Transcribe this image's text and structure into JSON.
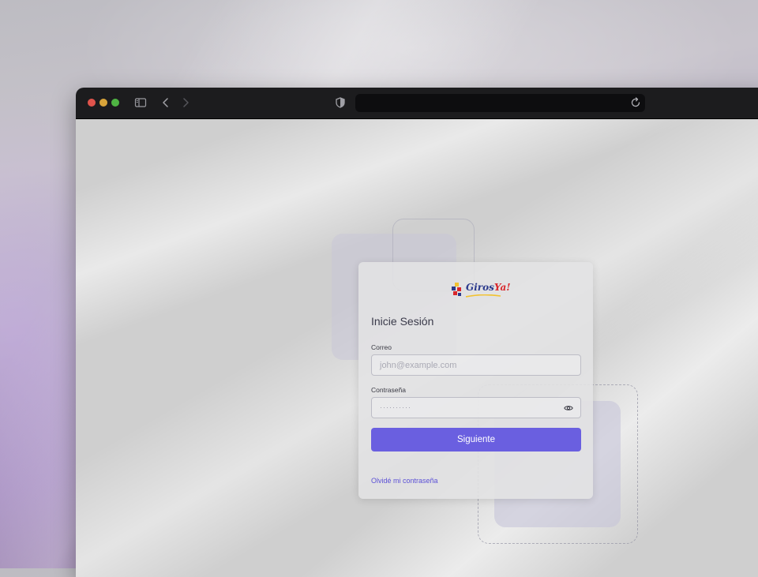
{
  "brand": {
    "logo_text_main": "Giros",
    "logo_text_accent": "Ya!",
    "accent_color": "#6a5fe0"
  },
  "browser": {
    "traffic_lights": [
      "close",
      "minimize",
      "maximize"
    ],
    "icons": [
      "sidebar-icon",
      "back-icon",
      "forward-icon",
      "shield-icon",
      "reload-icon"
    ],
    "address": ""
  },
  "login": {
    "title": "Inicie Sesión",
    "email_label": "Correo",
    "email_placeholder": "john@example.com",
    "password_label": "Contraseña",
    "password_mask": "··········",
    "submit_label": "Siguiente",
    "forgot_label": "Olvidé mi contraseña"
  }
}
